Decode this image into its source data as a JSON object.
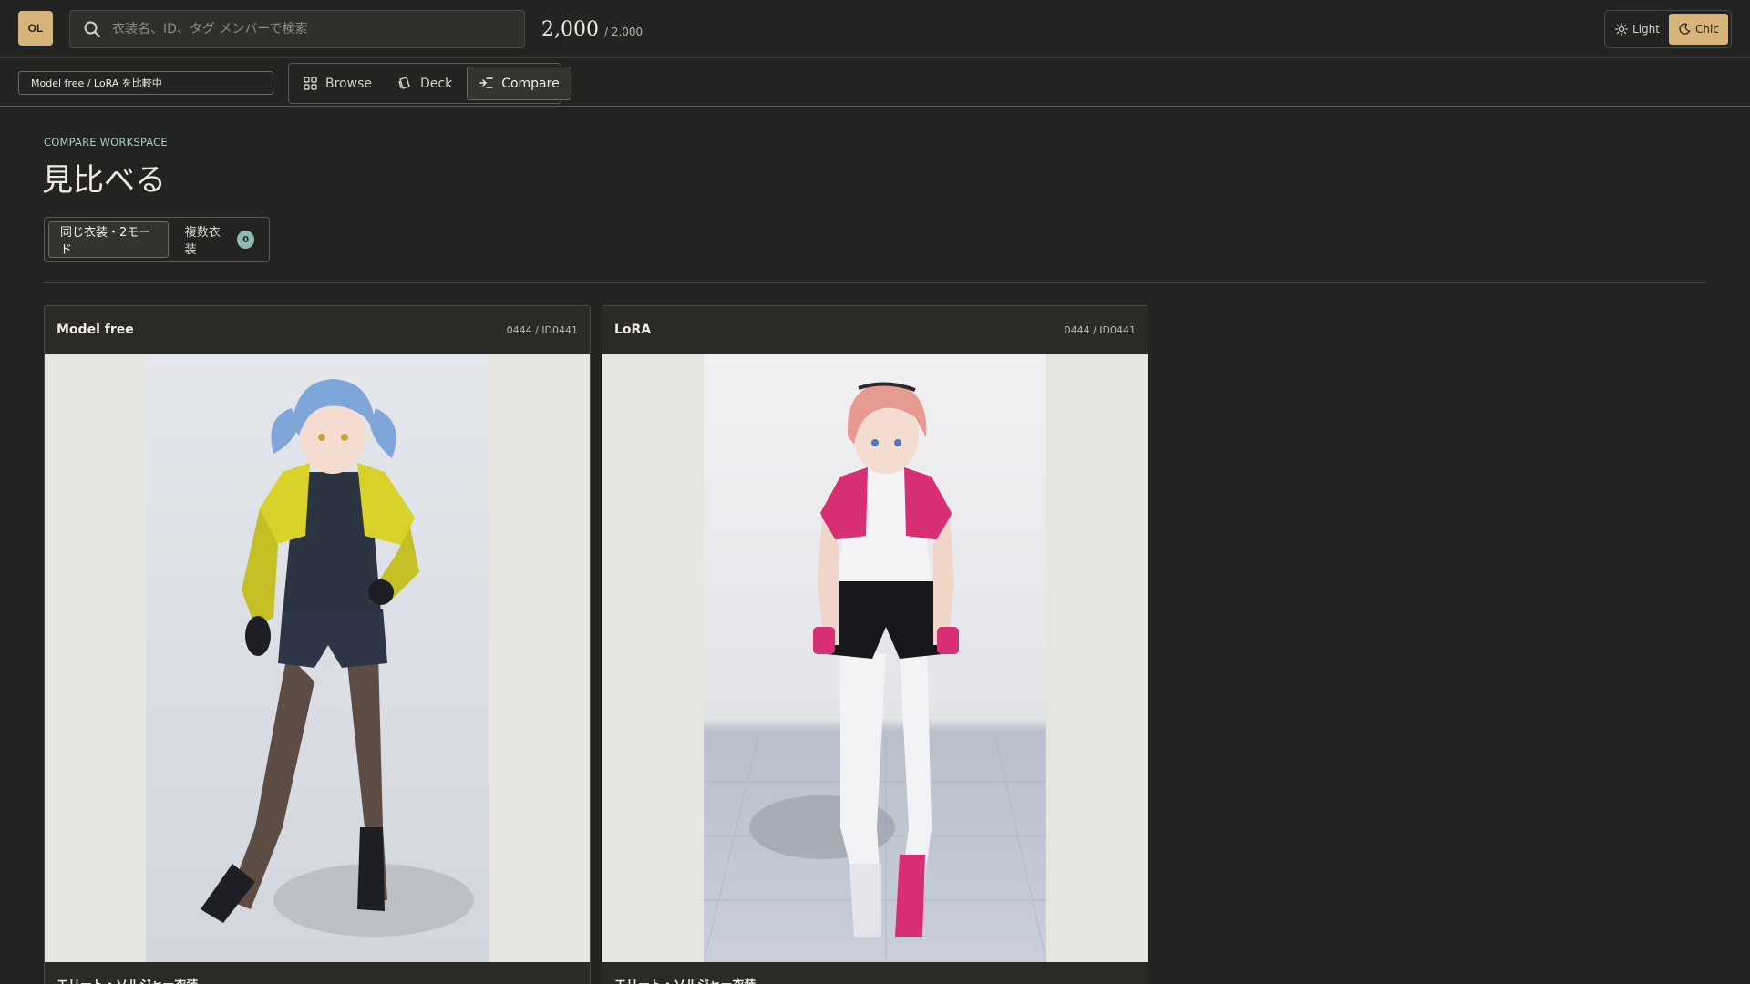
{
  "app": {
    "logo_text": "OL",
    "search_placeholder": "衣装名、ID、タグ メンバーで検索",
    "count_main": "2,000",
    "count_total": "/ 2,000",
    "theme": [
      {
        "label": "Light",
        "icon": "sun-icon",
        "active": false
      },
      {
        "label": "Chic",
        "icon": "moon-icon",
        "active": true
      }
    ]
  },
  "subbar": {
    "status": "Model free / LoRA を比較中",
    "tabs": [
      {
        "label": "Browse",
        "icon": "grid-icon",
        "active": false
      },
      {
        "label": "Deck",
        "icon": "cards-icon",
        "active": false
      },
      {
        "label": "Compare",
        "icon": "compare-icon",
        "active": true
      }
    ]
  },
  "main": {
    "eyebrow": "COMPARE WORKSPACE",
    "title": "見比べる",
    "modes": [
      {
        "label": "同じ衣装・2モード",
        "active": true
      },
      {
        "label": "複数衣装",
        "badge": "0",
        "active": false
      }
    ],
    "cards": [
      {
        "name": "Model free",
        "id": "0444 / ID0441",
        "caption": "エリート・ソルジャー衣装",
        "image": "anime-girl-blue-hair-yellow-jacket"
      },
      {
        "name": "LoRA",
        "id": "0444 / ID0441",
        "caption": "エリート・ソルジャー衣装",
        "image": "anime-girl-pink-hair-magenta-jacket"
      }
    ]
  },
  "colors": {
    "background": "#232321",
    "accent": "#d7b57a",
    "teal": "#a9cfc5"
  }
}
